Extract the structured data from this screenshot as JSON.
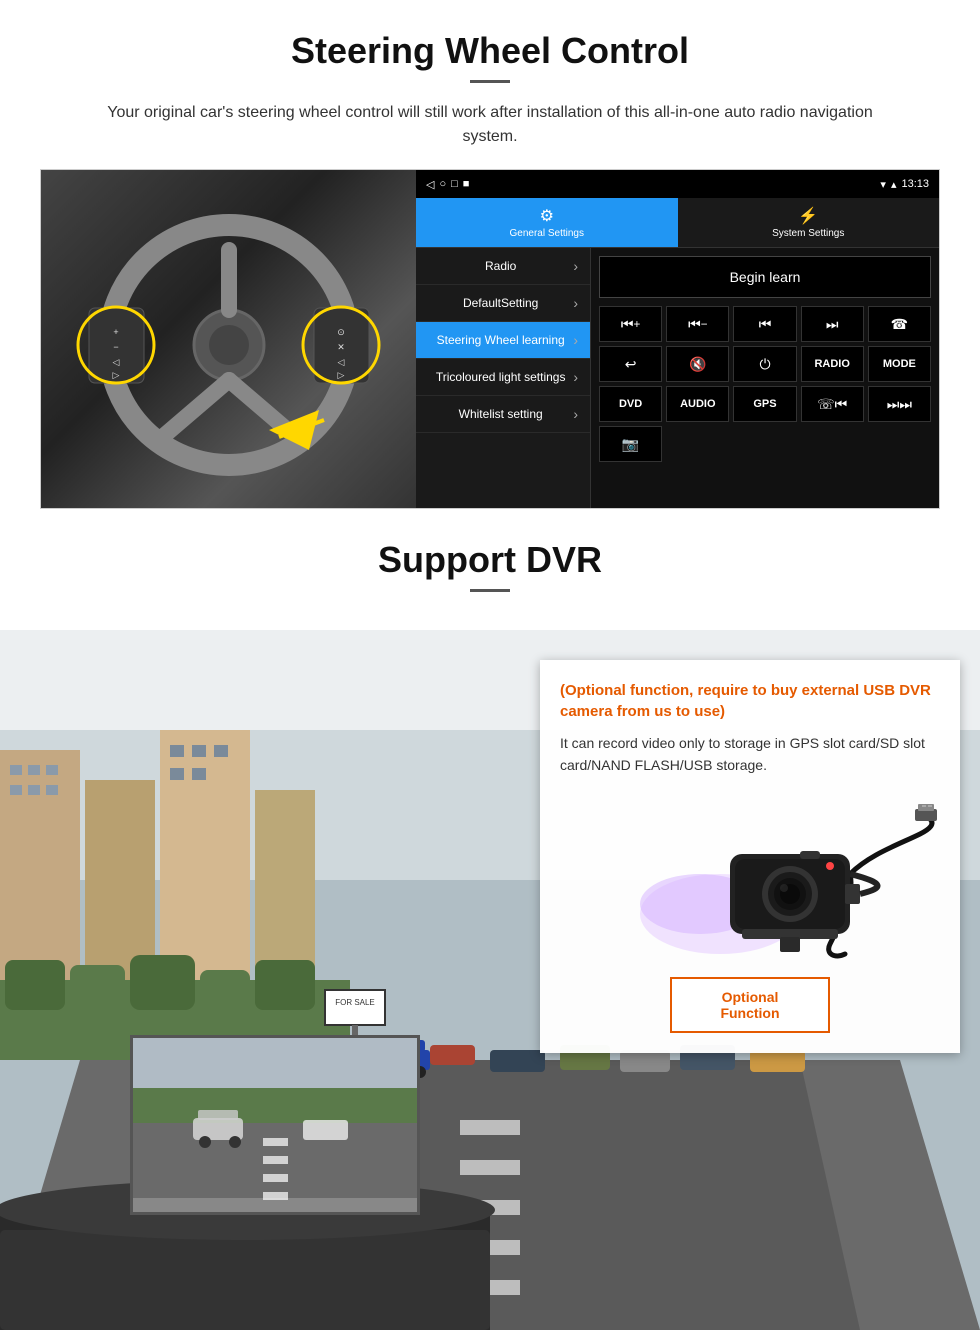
{
  "steering": {
    "title": "Steering Wheel Control",
    "subtitle": "Your original car's steering wheel control will still work after installation of this all-in-one auto radio navigation system.",
    "statusbar": {
      "time": "13:13",
      "icons": "▾ ▴ ● ■"
    },
    "tabs": {
      "general": "General Settings",
      "system": "System Settings"
    },
    "menu": {
      "items": [
        {
          "label": "Radio",
          "active": false
        },
        {
          "label": "DefaultSetting",
          "active": false
        },
        {
          "label": "Steering Wheel learning",
          "active": true
        },
        {
          "label": "Tricoloured light settings",
          "active": false
        },
        {
          "label": "Whitelist setting",
          "active": false
        }
      ]
    },
    "begin_learn": "Begin learn",
    "controls": {
      "row1": [
        "⏮+",
        "⏮−",
        "⏮",
        "⏭",
        "☏"
      ],
      "row2": [
        "↩",
        "🔇",
        "⏻",
        "RADIO",
        "MODE"
      ],
      "row3": [
        "DVD",
        "AUDIO",
        "GPS",
        "☏⏮",
        "⏭⏭"
      ],
      "row4": [
        "🎬"
      ]
    }
  },
  "dvr": {
    "title": "Support DVR",
    "card": {
      "title": "(Optional function, require to buy external USB DVR camera from us to use)",
      "body": "It can record video only to storage in GPS slot card/SD slot card/NAND FLASH/USB storage.",
      "optional_btn": "Optional Function"
    }
  }
}
